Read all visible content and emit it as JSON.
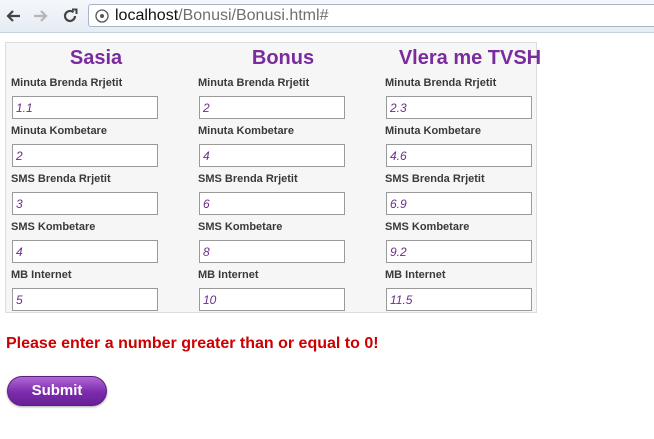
{
  "browser": {
    "url_host": "localhost",
    "url_path": "/Bonusi/Bonusi.html#"
  },
  "columns": [
    {
      "title": "Sasia",
      "rows": [
        {
          "label": "Minuta Brenda Rrjetit",
          "value": "1.1"
        },
        {
          "label": "Minuta Kombetare",
          "value": "2"
        },
        {
          "label": "SMS Brenda Rrjetit",
          "value": "3"
        },
        {
          "label": "SMS Kombetare",
          "value": "4"
        },
        {
          "label": "MB Internet",
          "value": "5"
        }
      ]
    },
    {
      "title": "Bonus",
      "rows": [
        {
          "label": "Minuta Brenda Rrjetit",
          "value": "2"
        },
        {
          "label": "Minuta Kombetare",
          "value": "4"
        },
        {
          "label": "SMS Brenda Rrjetit",
          "value": "6"
        },
        {
          "label": "SMS Kombetare",
          "value": "8"
        },
        {
          "label": "MB Internet",
          "value": "10"
        }
      ]
    },
    {
      "title": "Vlera me TVSH",
      "rows": [
        {
          "label": "Minuta Brenda Rrjetit",
          "value": "2.3"
        },
        {
          "label": "Minuta Kombetare",
          "value": "4.6"
        },
        {
          "label": "SMS Brenda Rrjetit",
          "value": "6.9"
        },
        {
          "label": "SMS Kombetare",
          "value": "9.2"
        },
        {
          "label": "MB Internet",
          "value": "11.5"
        }
      ]
    }
  ],
  "error_message": "Please enter a number greater than or equal to 0!",
  "submit_label": "Submit",
  "colors": {
    "accent_purple": "#7a2b9e",
    "error_red": "#cc0000"
  }
}
